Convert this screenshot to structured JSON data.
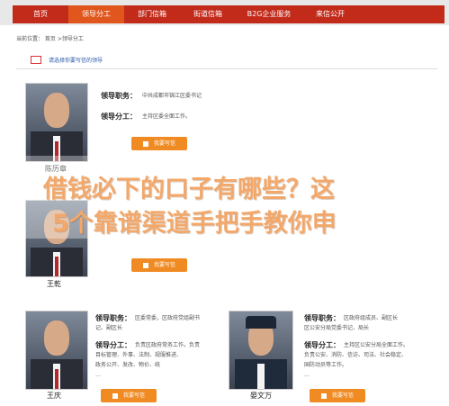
{
  "nav": [
    "首页",
    "领导分工",
    "部门信箱",
    "街道信箱",
    "B2G企业服务",
    "来信公开"
  ],
  "breadcrumb": "当前位置：  首页  >领导分工",
  "notice": "请选择你要写信的领导",
  "labels": {
    "position": "领导职务：",
    "division": "领导分工："
  },
  "write_button": "我要写信",
  "overlay_text": {
    "line1": "借钱必下的口子有哪些？这",
    "line2": "5个靠谱渠道手把手教你申"
  },
  "leaders": [
    {
      "name": "陈历章",
      "position": "中共成都市锦江区委书记",
      "division": "主持区委全面工作。"
    },
    {
      "name": "王乾",
      "position": "",
      "division": ""
    },
    {
      "name": "王庆",
      "position_line1": "区委常委，区政府党组副书",
      "position_line2": "记、副区长",
      "division_lines": [
        "负责区政府常务工作。负责",
        "目标管理、外事、法制、规服推进、",
        "政务公开、发改、物价、统",
        "…"
      ]
    },
    {
      "name": "晏文万",
      "position_line1": "区政府组成员、副区长",
      "position_line2": "区公安分局党委书记、局长",
      "division_lines": [
        "主持区公安分局全面工作。",
        "负责公安、消防、信访、司法、社会稳定、",
        "国防动员等工作。",
        "…"
      ]
    }
  ],
  "colors": {
    "nav_bg": "#c22a1a",
    "nav_active": "#e0561d",
    "button": "#f08a22",
    "overlay_text": "#f2a86a",
    "notice": "#2a5aa8"
  }
}
